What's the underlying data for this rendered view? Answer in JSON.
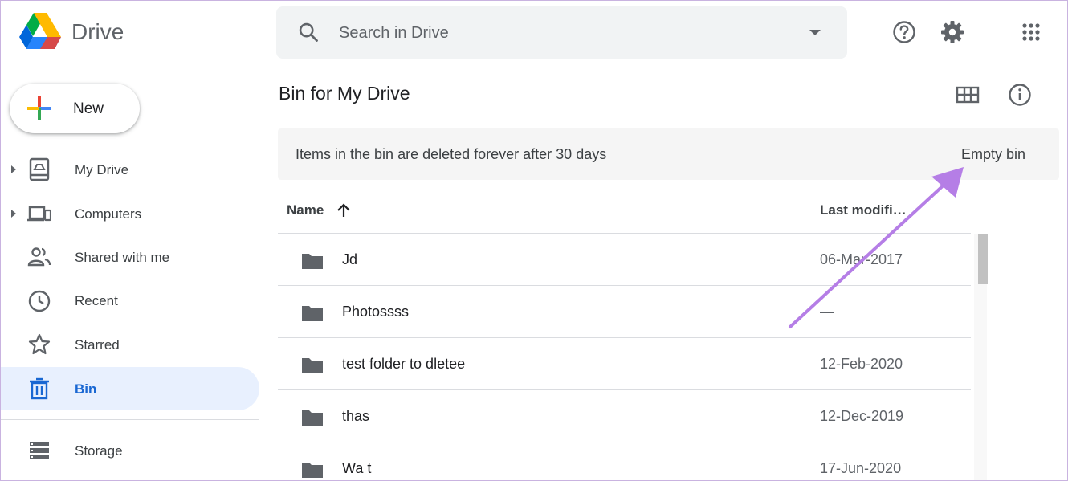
{
  "header": {
    "app_name": "Drive",
    "search_placeholder": "Search in Drive",
    "icons": [
      "drive-logo",
      "search-icon",
      "dropdown-caret-icon",
      "help-icon",
      "settings-gear-icon",
      "apps-grid-icon"
    ]
  },
  "sidebar": {
    "new_label": "New",
    "items": [
      {
        "label": "My Drive",
        "icon": "my-drive-icon",
        "expandable": true,
        "active": false
      },
      {
        "label": "Computers",
        "icon": "computers-icon",
        "expandable": true,
        "active": false
      },
      {
        "label": "Shared with me",
        "icon": "shared-people-icon",
        "expandable": false,
        "active": false
      },
      {
        "label": "Recent",
        "icon": "clock-icon",
        "expandable": false,
        "active": false
      },
      {
        "label": "Starred",
        "icon": "star-icon",
        "expandable": false,
        "active": false
      },
      {
        "label": "Bin",
        "icon": "trash-icon",
        "expandable": false,
        "active": true
      },
      {
        "label": "Storage",
        "icon": "storage-icon",
        "expandable": false,
        "active": false
      }
    ]
  },
  "main": {
    "title": "Bin for My Drive",
    "banner_text": "Items in the bin are deleted forever after 30 days",
    "empty_bin_label": "Empty bin",
    "columns": {
      "name": "Name",
      "last_modified": "Last modifi…"
    },
    "rows": [
      {
        "name": "Jd",
        "date": "06-Mar-2017"
      },
      {
        "name": "Photossss",
        "date": "—"
      },
      {
        "name": "test folder to dletee",
        "date": "12-Feb-2020"
      },
      {
        "name": "thas",
        "date": "12-Dec-2019"
      },
      {
        "name": "Wa t",
        "date": "17-Jun-2020"
      }
    ]
  },
  "colors": {
    "accent_blue": "#1967d2",
    "active_bg": "#e8f0fe",
    "annotation_arrow": "#b57ee6",
    "icon_gray": "#5f6368"
  }
}
